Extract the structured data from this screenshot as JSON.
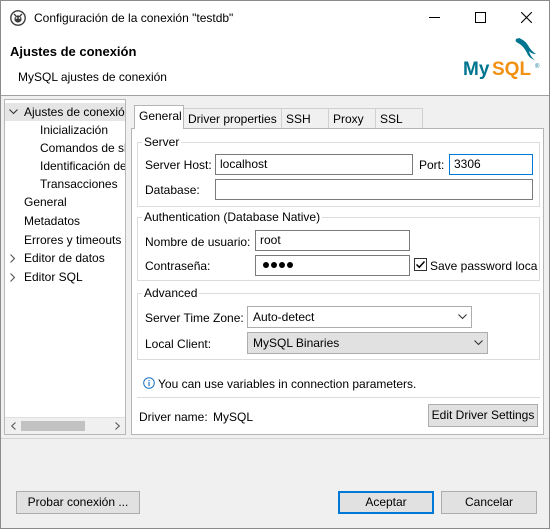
{
  "window": {
    "title": "Configuración de la conexión \"testdb\"",
    "app_icon": "dbeaver-icon",
    "controls": [
      "minimize-icon",
      "maximize-icon",
      "close-icon"
    ]
  },
  "header": {
    "title": "Ajustes de conexión",
    "subtitle": "MySQL ajustes de conexión",
    "logo": {
      "text": "MySQL",
      "trademark": "®",
      "color_my": "#00758f",
      "color_sql": "#f29111"
    }
  },
  "tree": {
    "items": [
      {
        "label": "Ajustes de conexión",
        "expander": "expanded",
        "selected": true
      },
      {
        "label": "Inicialización",
        "child": true
      },
      {
        "label": "Comandos de shell",
        "child": true
      },
      {
        "label": "Identificación de cliente",
        "child": true
      },
      {
        "label": "Transacciones",
        "child": true
      },
      {
        "label": "General"
      },
      {
        "label": "Metadatos"
      },
      {
        "label": "Errores y timeouts"
      },
      {
        "label": "Editor de datos",
        "expander": "collapsed"
      },
      {
        "label": "Editor SQL",
        "expander": "collapsed"
      }
    ]
  },
  "tabs": [
    {
      "label": "General",
      "active": true
    },
    {
      "label": "Driver properties"
    },
    {
      "label": "SSH"
    },
    {
      "label": "Proxy"
    },
    {
      "label": "SSL"
    }
  ],
  "server": {
    "group_label": "Server",
    "host_label": "Server Host:",
    "host_value": "localhost",
    "port_label": "Port:",
    "port_value": "3306",
    "database_label": "Database:",
    "database_value": ""
  },
  "auth": {
    "group_label": "Authentication (Database Native)",
    "user_label": "Nombre de usuario:",
    "user_value": "root",
    "password_label": "Contraseña:",
    "password_mask_count": 4,
    "save_password_label": "Save password loca",
    "save_password_checked": true
  },
  "advanced": {
    "group_label": "Advanced",
    "timezone_label": "Server Time Zone:",
    "timezone_value": "Auto-detect",
    "client_label": "Local Client:",
    "client_value": "MySQL Binaries"
  },
  "info_text": "You can use variables in connection parameters.",
  "driver": {
    "label": "Driver name:",
    "value": "MySQL",
    "edit_button": "Edit Driver Settings"
  },
  "footer": {
    "test_button": "Probar conexión ...",
    "accept_button": "Aceptar",
    "cancel_button": "Cancelar"
  },
  "colors": {
    "accent": "#0078d7",
    "info": "#1a73c7"
  }
}
